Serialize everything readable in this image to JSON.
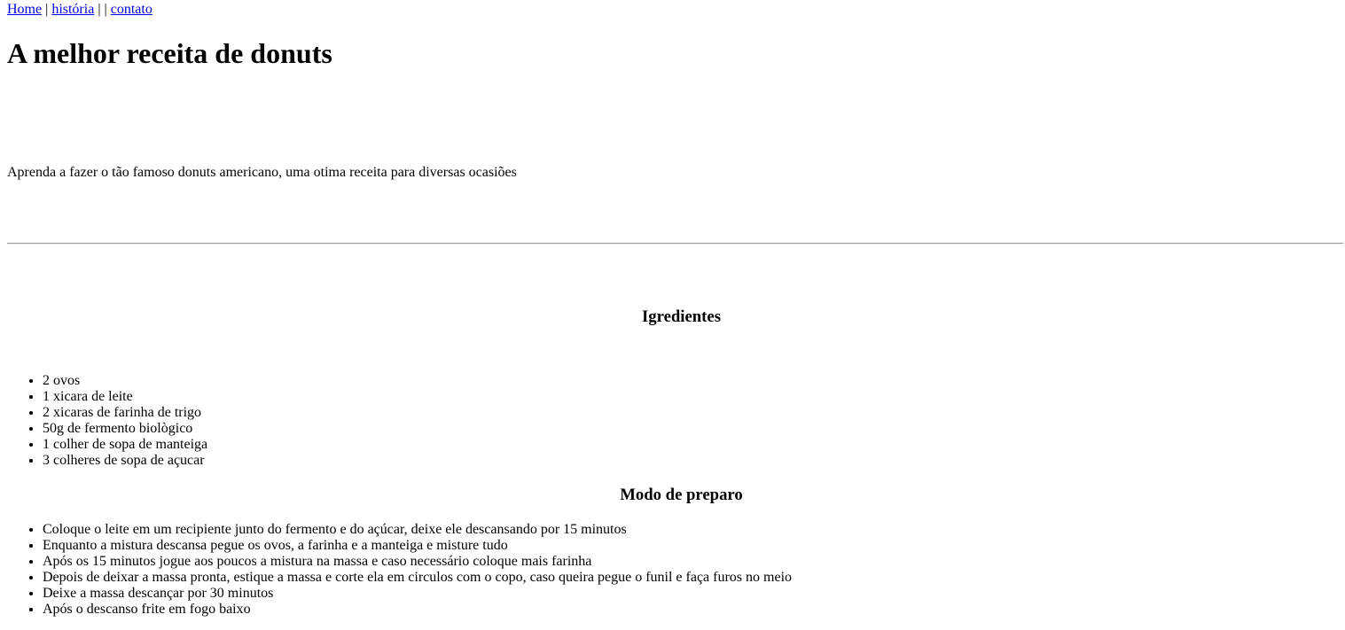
{
  "nav": {
    "home": "Home",
    "sep1": " | ",
    "historia": "história",
    "sep2": " | | ",
    "contato": "contato"
  },
  "page_title": "A melhor receita de donuts",
  "intro": "Aprenda a fazer o tão famoso donuts americano, uma otima receita para diversas ocasiões",
  "ingredients": {
    "title": "Igredientes",
    "items": [
      "2 ovos",
      "1 xicara de leite",
      "2 xicaras de farinha de trigo",
      "50g de fermento biològico",
      "1 colher de sopa de manteiga",
      "3 colheres de sopa de açucar"
    ]
  },
  "preparation": {
    "title": "Modo de preparo",
    "steps": [
      "Coloque o leite em um recipiente junto do fermento e do açúcar, deixe ele descansando por 15 minutos",
      "Enquanto a mistura descansa pegue os ovos, a farinha e a manteiga e misture tudo",
      "Após os 15 minutos jogue aos poucos a mistura na massa e caso necessário coloque mais farinha",
      "Depois de deixar a massa pronta, estique a massa e corte ela em circulos com o copo, caso queira pegue o funil e faça furos no meio",
      "Deixe a massa descançar por 30 minutos",
      "Após o descanso frite em fogo baixo"
    ]
  },
  "colors": {
    "link": "#0000ee",
    "text": "#000000",
    "background": "#ffffff"
  }
}
